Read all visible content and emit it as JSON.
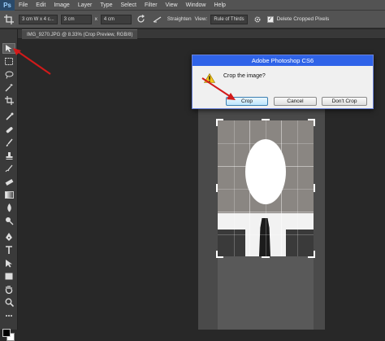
{
  "app": {
    "logo": "Ps"
  },
  "menu": [
    "File",
    "Edit",
    "Image",
    "Layer",
    "Type",
    "Select",
    "Filter",
    "View",
    "Window",
    "Help"
  ],
  "options": {
    "ratio_preset": "3 cm W x 4 c...",
    "width": "3 cm",
    "swap": "x",
    "height": "4 cm",
    "straighten_label": "Straighten",
    "view_label": "View:",
    "view_value": "Rule of Thirds",
    "delete_cropped_label": "Delete Cropped Pixels",
    "delete_cropped_checked": true
  },
  "document": {
    "tab_title": "IMG_9270.JPG @ 8.33% (Crop Preview, RGB/8)"
  },
  "dialog": {
    "title": "Adobe Photoshop CS6",
    "message": "Crop the image?",
    "buttons": {
      "crop": "Crop",
      "cancel": "Cancel",
      "dont_crop": "Don't Crop"
    }
  },
  "colors": {
    "dialog_title_bar": "#2f63e8",
    "annotation_arrow": "#d21a1a",
    "foreground_swatch": "#000000",
    "background_swatch": "#ffffff"
  },
  "icons": {
    "crop_tool": "crop-icon",
    "warning": "warning-icon",
    "rotate": "rotate-icon"
  }
}
